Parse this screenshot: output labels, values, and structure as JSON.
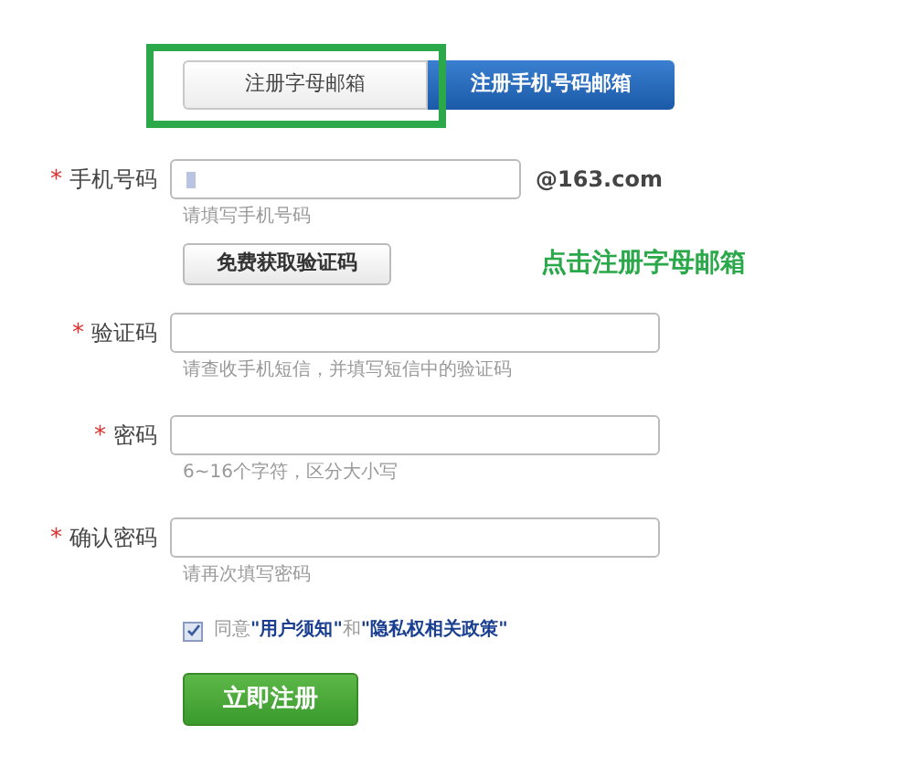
{
  "tabs": [
    {
      "label": "注册字母邮箱",
      "selected": false
    },
    {
      "label": "注册手机号码邮箱",
      "selected": true
    }
  ],
  "annotation": {
    "text": "点击注册字母邮箱"
  },
  "phone": {
    "label": "手机号码",
    "mark": "*",
    "suffix": "@163.com",
    "hint": "请填写手机号码"
  },
  "code_button": "免费获取验证码",
  "fields": [
    {
      "label": "验证码",
      "mark": "*",
      "hint": "请查收手机短信，并填写短信中的验证码"
    },
    {
      "label": "密码",
      "mark": "*",
      "hint": "6~16个字符，区分大小写"
    },
    {
      "label": "确认密码",
      "mark": "*",
      "hint": "请再次填写密码"
    }
  ],
  "agreement": {
    "checked": true,
    "parts": [
      {
        "kind": "text",
        "text": "同意"
      },
      {
        "kind": "link",
        "text": "\"用户须知\""
      },
      {
        "kind": "text",
        "text": "和"
      },
      {
        "kind": "link",
        "text": "\"隐私权相关政策\""
      }
    ]
  },
  "submit": "立即注册"
}
